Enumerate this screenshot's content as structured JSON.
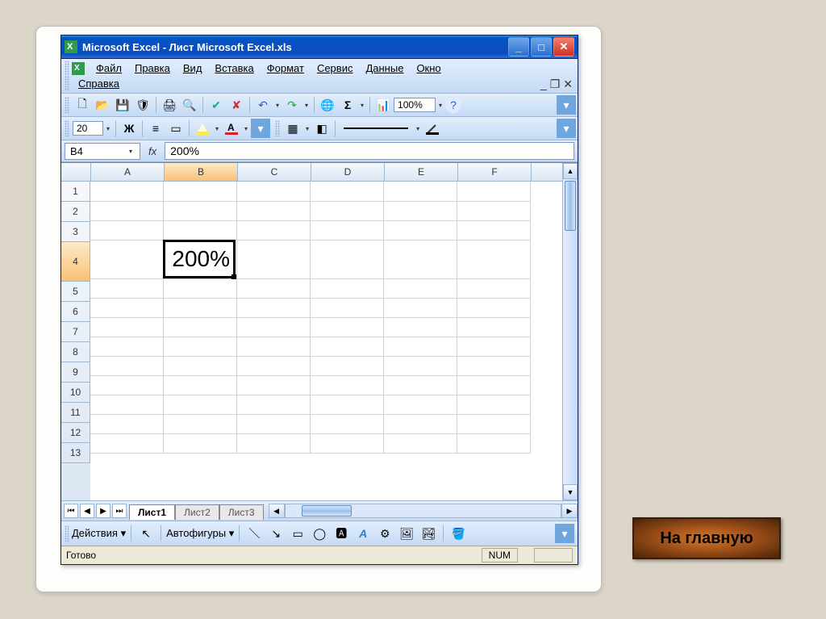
{
  "window": {
    "title": "Microsoft Excel - Лист Microsoft Excel.xls"
  },
  "menu": {
    "file": "Файл",
    "edit": "Правка",
    "view": "Вид",
    "insert": "Вставка",
    "format": "Формат",
    "tools": "Сервис",
    "data": "Данные",
    "window": "Окно",
    "help": "Справка"
  },
  "toolbar": {
    "zoom": "100%",
    "fontsize": "20"
  },
  "namebox": {
    "cell_ref": "B4",
    "formula_value": "200%"
  },
  "grid": {
    "columns": [
      "A",
      "B",
      "C",
      "D",
      "E",
      "F"
    ],
    "rows": [
      "1",
      "2",
      "3",
      "4",
      "5",
      "6",
      "7",
      "8",
      "9",
      "10",
      "11",
      "12",
      "13"
    ],
    "active_col": "B",
    "active_row": "4",
    "cell_value": "200%"
  },
  "tabs": {
    "t1": "Лист1",
    "t2": "Лист2",
    "t3": "Лист3"
  },
  "drawing": {
    "actions": "Действия",
    "autoshapes": "Автофигуры"
  },
  "status": {
    "ready": "Готово",
    "num": "NUM"
  },
  "home_button": "На главную"
}
